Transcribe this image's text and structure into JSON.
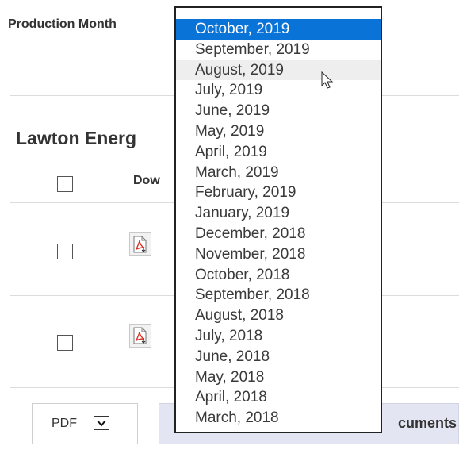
{
  "production_month": {
    "label": "Production Month",
    "options": [
      "October, 2019",
      "September, 2019",
      "August, 2019",
      "July, 2019",
      "June, 2019",
      "May, 2019",
      "April, 2019",
      "March, 2019",
      "February, 2019",
      "January, 2019",
      "December, 2018",
      "November, 2018",
      "October, 2018",
      "September, 2018",
      "August, 2018",
      "July, 2018",
      "June, 2018",
      "May, 2018",
      "April, 2018",
      "March, 2018"
    ],
    "selected": "October, 2019",
    "hovered": "August, 2019"
  },
  "panel": {
    "title": "Lawton Energ",
    "download_header": "Dow"
  },
  "format_select": {
    "value": "PDF"
  },
  "documents_button": {
    "label": "cuments"
  },
  "colors": {
    "selected_bg": "#0a73d8",
    "button_bg": "#e3e6f2",
    "pdf_red": "#d93025"
  },
  "icons": [
    "pdf-download-icon",
    "chevron-down-icon",
    "mouse-cursor-icon"
  ]
}
